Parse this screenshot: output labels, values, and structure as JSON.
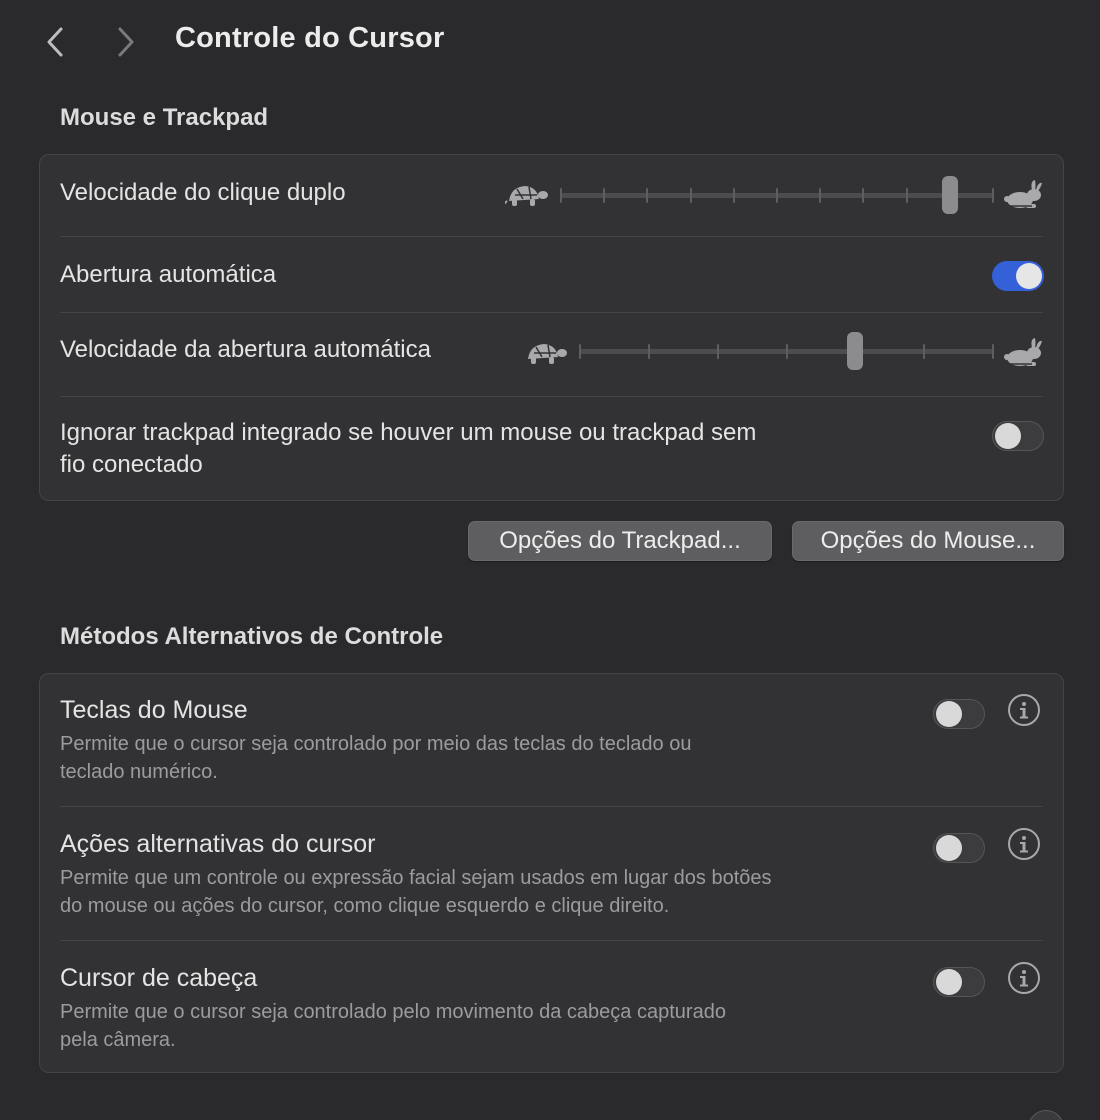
{
  "header": {
    "title": "Controle do Cursor",
    "back_icon": "chevron-left-icon",
    "forward_icon": "chevron-right-icon"
  },
  "mouse_trackpad": {
    "heading": "Mouse e Trackpad",
    "double_click_speed": {
      "label": "Velocidade do clique duplo",
      "slow_icon": "turtle-icon",
      "fast_icon": "rabbit-icon",
      "tick_count": 11,
      "selected_stop": 9
    },
    "spring_loading": {
      "label": "Abertura automática",
      "enabled": true
    },
    "spring_loading_speed": {
      "label": "Velocidade da abertura automática",
      "slow_icon": "turtle-icon",
      "fast_icon": "rabbit-icon",
      "tick_count": 7,
      "selected_stop": 4
    },
    "ignore_builtin": {
      "label_line1": "Ignorar trackpad integrado se houver um mouse ou trackpad sem",
      "label_line2": "fio conectado",
      "enabled": false
    }
  },
  "buttons": {
    "trackpad_options": "Opções do Trackpad...",
    "mouse_options": "Opções do Mouse..."
  },
  "alt_control": {
    "heading": "Métodos Alternativos de Controle",
    "items": [
      {
        "title": "Teclas do Mouse",
        "desc_line1": "Permite que o cursor seja controlado por meio das teclas do teclado ou",
        "desc_line2": "teclado numérico.",
        "enabled": false
      },
      {
        "title": "Ações alternativas do cursor",
        "desc_line1": "Permite que um controle ou expressão facial sejam usados em lugar dos botões",
        "desc_line2": "do mouse ou ações do cursor, como clique esquerdo e clique direito.",
        "enabled": false
      },
      {
        "title": "Cursor de cabeça",
        "desc_line1": "Permite que o cursor seja controlado pelo movimento da cabeça capturado",
        "desc_line2": "pela câmera.",
        "enabled": false
      }
    ]
  },
  "colors": {
    "background": "#2a2a2c",
    "group": "#323234",
    "accent": "#3461d8"
  }
}
